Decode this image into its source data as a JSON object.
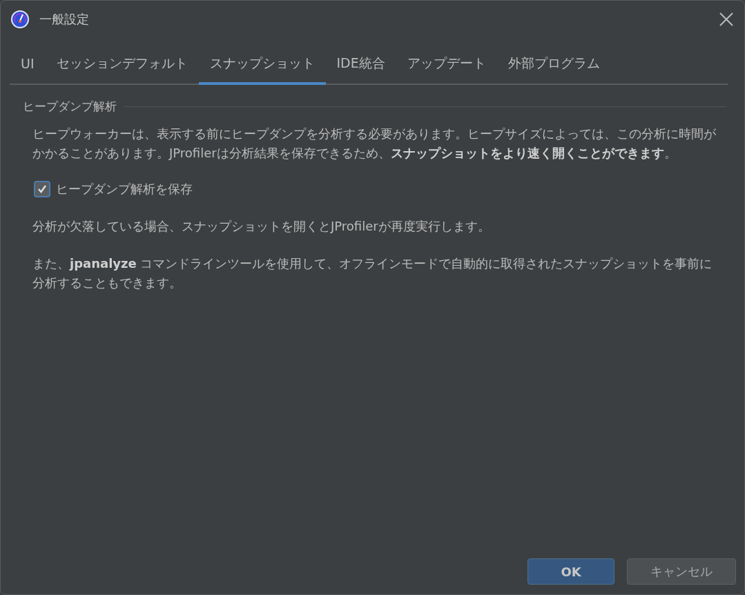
{
  "window": {
    "title": "一般設定"
  },
  "tabs": [
    {
      "label": "UI",
      "selected": false
    },
    {
      "label": "セッションデフォルト",
      "selected": false
    },
    {
      "label": "スナップショット",
      "selected": true
    },
    {
      "label": "IDE統合",
      "selected": false
    },
    {
      "label": "アップデート",
      "selected": false
    },
    {
      "label": "外部プログラム",
      "selected": false
    }
  ],
  "section": {
    "title": "ヒープダンプ解析",
    "intro": "ヒープウォーカーは、表示する前にヒープダンプを分析する必要があります。ヒープサイズによっては、この分析に時間がかかることがあります。JProfilerは分析結果を保存できるため、**スナップショットをより速く開くことができます**。",
    "checkbox": {
      "label": "ヒープダンプ解析を保存",
      "checked": true
    },
    "notes": [
      "分析が欠落している場合、スナップショットを開くとJProfilerが再度実行します。",
      "また、**jpanalyze** コマンドラインツールを使用して、オフラインモードで自動的に取得されたスナップショットを事前に分析することもできます。"
    ]
  },
  "buttons": [
    {
      "label": "OK",
      "kind": "primary"
    },
    {
      "label": "キャンセル",
      "kind": "secondary"
    }
  ]
}
